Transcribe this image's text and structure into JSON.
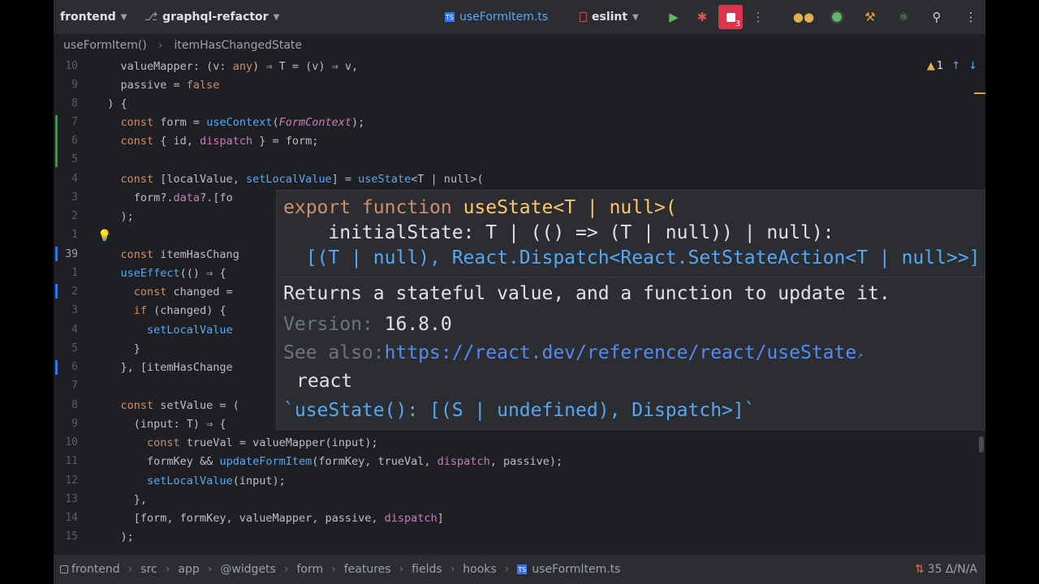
{
  "toolbar": {
    "project": "frontend",
    "branch": "graphql-refactor",
    "file_tab": "useFormItem.ts",
    "run_config": "eslint",
    "badge_count": "3"
  },
  "breadcrumb": [
    "useFormItem()",
    "itemHasChangedState"
  ],
  "inspection": {
    "warnings": "1"
  },
  "editor": {
    "lines": [
      {
        "num": "10",
        "t": "    valueMapper: (v: any) ⇒ T = (v) ⇒ v,"
      },
      {
        "num": "9",
        "t": "    passive = false"
      },
      {
        "num": "8",
        "t": "  ) {"
      },
      {
        "num": "7",
        "t": "    const form = useContext(FormContext);"
      },
      {
        "num": "6",
        "t": "    const { id, dispatch } = form;"
      },
      {
        "num": "5",
        "t": ""
      },
      {
        "num": "4",
        "t": "    const [localValue, setLocalValue] = useState<T | null>("
      },
      {
        "num": "3",
        "t": "      form?.data?.[fo"
      },
      {
        "num": "2",
        "t": "    );"
      },
      {
        "num": "1",
        "t": ""
      },
      {
        "num": "39",
        "t": "    const itemHasChang"
      },
      {
        "num": "1",
        "t": "    useEffect(() ⇒ {"
      },
      {
        "num": "2",
        "t": "      const changed = "
      },
      {
        "num": "3",
        "t": "      if (changed) {"
      },
      {
        "num": "4",
        "t": "        setLocalValue"
      },
      {
        "num": "5",
        "t": "      }"
      },
      {
        "num": "6",
        "t": "    }, [itemHasChange"
      },
      {
        "num": "7",
        "t": ""
      },
      {
        "num": "8",
        "t": "    const setValue = ("
      },
      {
        "num": "9",
        "t": "      (input: T) ⇒ {"
      },
      {
        "num": "10",
        "t": "        const trueVal = valueMapper(input);"
      },
      {
        "num": "11",
        "t": "        formKey && updateFormItem(formKey, trueVal, dispatch, passive);"
      },
      {
        "num": "12",
        "t": "        setLocalValue(input);"
      },
      {
        "num": "13",
        "t": "      },"
      },
      {
        "num": "14",
        "t": "      [form, formKey, valueMapper, passive, dispatch]"
      },
      {
        "num": "15",
        "t": "    );"
      }
    ]
  },
  "popup": {
    "sig1_kw": "export function ",
    "sig1_name": "useState",
    "sig1_rest": "<T | null>(",
    "sig2": "    initialState: T | (() => (T | null)) | null):",
    "sig3": "  [(T | null), React.Dispatch<React.SetStateAction<T | null>>]",
    "description": "Returns a stateful value, and a function to update it.",
    "version_label": "Version:",
    "version_value": "16.8.0",
    "see_label": "See also:",
    "see_link": "https://react.dev/reference/react/useState",
    "library": "react",
    "signature_hint": "`useState(): [(S | undefined), Dispatch>]`"
  },
  "status": {
    "path": [
      "frontend",
      "src",
      "app",
      "@widgets",
      "form",
      "features",
      "fields",
      "hooks",
      "useFormItem.ts"
    ],
    "right": "35 Δ/N/A"
  },
  "colors": {
    "bg": "#1e1f22",
    "panel": "#2b2d30",
    "keyword": "#cf8e6d",
    "function": "#56a8f5",
    "link": "#548af7",
    "badge": "#d9364c"
  }
}
